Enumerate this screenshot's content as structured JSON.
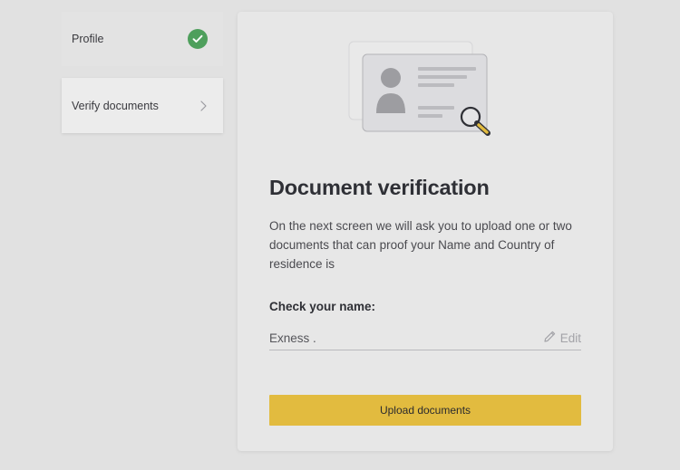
{
  "sidebar": {
    "steps": [
      {
        "label": "Profile",
        "status": "completed",
        "icon": "check-circle-icon"
      },
      {
        "label": "Verify documents",
        "status": "current",
        "icon": "chevron-right-icon"
      }
    ]
  },
  "card": {
    "illustration": "id-card-magnifier-illustration",
    "title": "Document verification",
    "description": "On the next screen we will ask you to upload one or two documents that can proof your Name and Country of residence is",
    "name_section": {
      "label": "Check your name:",
      "value": "Exness .",
      "edit_label": "Edit",
      "edit_icon": "pencil-icon"
    },
    "upload_button_label": "Upload documents"
  },
  "colors": {
    "background": "#e1e1e1",
    "card": "#e7e7e7",
    "accent": "#e2bb3f",
    "success": "#4e9f5c"
  }
}
